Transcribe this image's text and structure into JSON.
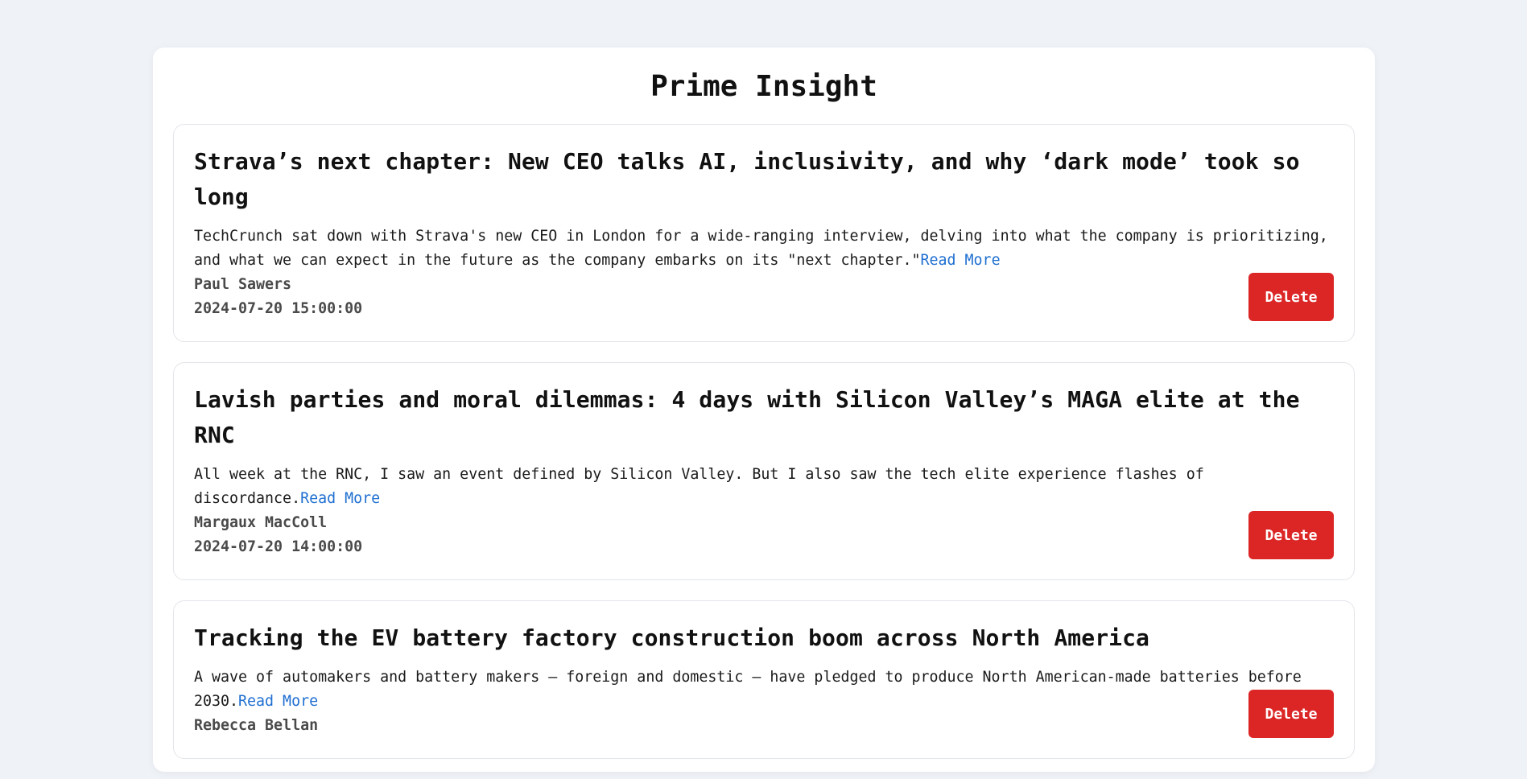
{
  "page": {
    "title": "Prime Insight"
  },
  "articles": [
    {
      "title": "Strava’s next chapter: New CEO talks AI, inclusivity, and why ‘dark mode’ took so long",
      "summary": "TechCrunch sat down with Strava's new CEO in London for a wide-ranging interview, delving into what the company is prioritizing, and what we can expect in the future as the company embarks on its \"next chapter.\"",
      "read_more": "Read More",
      "author": "Paul Sawers",
      "date": "2024-07-20 15:00:00",
      "delete_label": "Delete"
    },
    {
      "title": "Lavish parties and moral dilemmas: 4 days with Silicon Valley’s MAGA elite at the RNC",
      "summary": "All week at the RNC, I saw an event defined by Silicon Valley. But I also saw the tech elite experience flashes of discordance.",
      "read_more": "Read More",
      "author": "Margaux MacColl",
      "date": "2024-07-20 14:00:00",
      "delete_label": "Delete"
    },
    {
      "title": "Tracking the EV battery factory construction boom across North America",
      "summary": "A wave of automakers and battery makers — foreign and domestic — have pledged to produce North American-made batteries before 2030.",
      "read_more": "Read More",
      "author": "Rebecca Bellan",
      "date": "",
      "delete_label": "Delete"
    }
  ],
  "colors": {
    "background": "#eff2f7",
    "card": "#ffffff",
    "link": "#1f6fd1",
    "delete": "#dc2626"
  }
}
